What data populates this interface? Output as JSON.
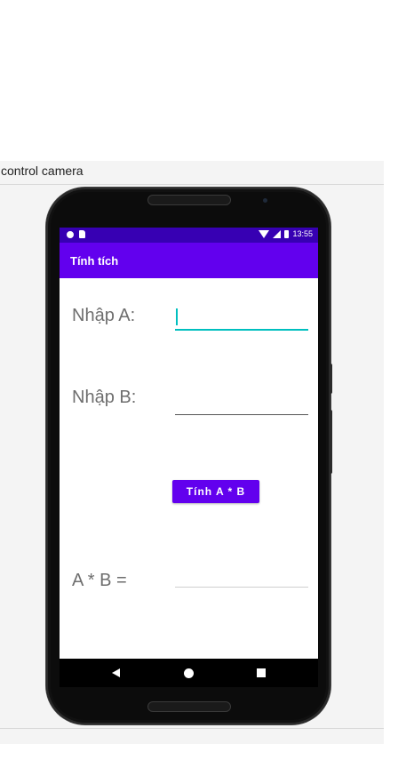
{
  "panel": {
    "title": "control camera"
  },
  "status_bar": {
    "time": "13:55"
  },
  "app": {
    "title": "Tính tích",
    "field_a": {
      "label": "Nhập A:",
      "value": ""
    },
    "field_b": {
      "label": "Nhập B:",
      "value": ""
    },
    "button_label": "Tính A * B",
    "result_label": "A * B =",
    "result_value": ""
  },
  "colors": {
    "status_bar": "#3700b3",
    "app_bar": "#6200ee",
    "accent": "#00bfbf"
  },
  "icons": [
    "dot-icon",
    "sd-card-icon",
    "wifi-icon",
    "signal-icon",
    "battery-icon",
    "back-icon",
    "home-icon",
    "recent-apps-icon"
  ]
}
